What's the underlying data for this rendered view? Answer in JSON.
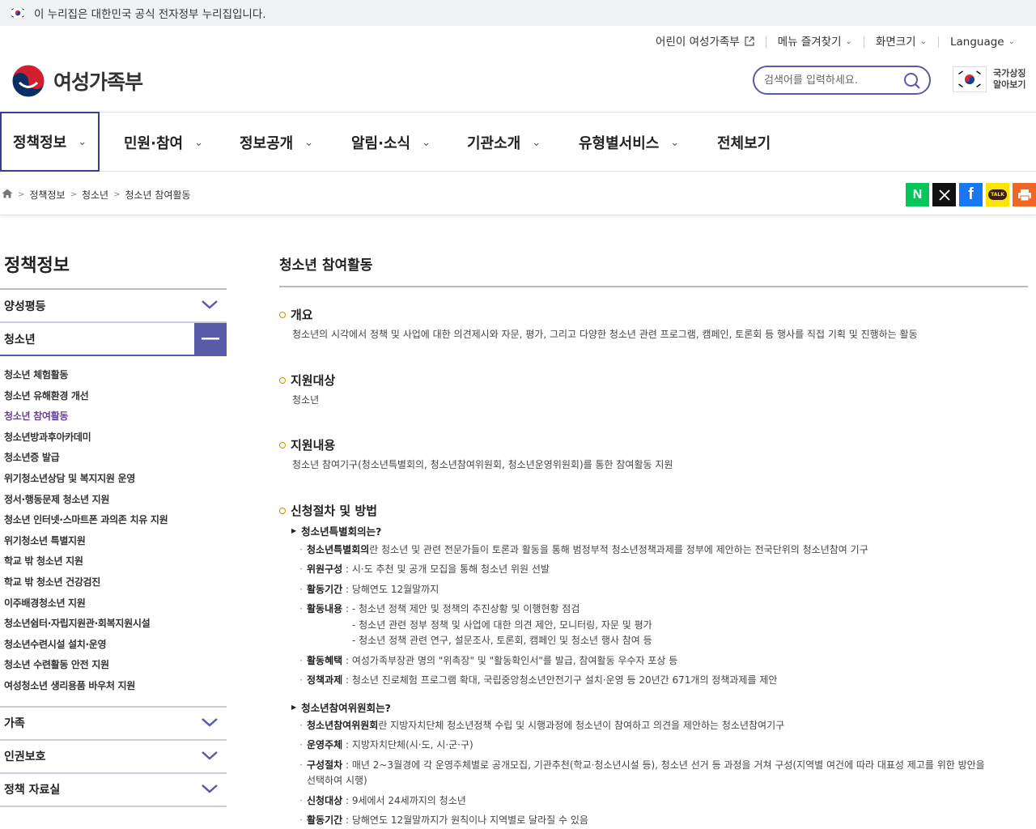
{
  "gov_banner": {
    "text": "이 누리집은 대한민국 공식 전자정부 누리집입니다."
  },
  "utility": {
    "kids": "어린이 여성가족부",
    "favorites": "메뉴 즐겨찾기",
    "font_size": "화면크기",
    "language": "Language"
  },
  "header": {
    "logo_text": "여성가족부",
    "search_placeholder": "검색어를 입력하세요.",
    "symbol_line1": "국가상징",
    "symbol_line2": "알아보기"
  },
  "gnb": {
    "tabs": [
      {
        "label": "정책정보"
      },
      {
        "label": "민원·참여"
      },
      {
        "label": "정보공개"
      },
      {
        "label": "알림·소식"
      },
      {
        "label": "기관소개"
      },
      {
        "label": "유형별서비스"
      },
      {
        "label": "전체보기"
      }
    ]
  },
  "breadcrumb": [
    "정책정보",
    "청소년",
    "청소년 참여활동"
  ],
  "share": {
    "naver": "N",
    "x": "X",
    "facebook": "f",
    "kakao": "TALK"
  },
  "colors": {
    "accent": "#5a5ba8",
    "active_sub": "#6b3fa0",
    "bullet_ring": "#d48a00",
    "naver": "#03c75a",
    "facebook": "#1877f2",
    "kakao": "#fee500",
    "print": "#f26522"
  },
  "lnb": {
    "title": "정책정보",
    "groups": [
      "양성평등",
      "청소년",
      "가족",
      "인권보호",
      "정책 자료실"
    ],
    "sub_items": [
      "청소년 체험활동",
      "청소년 유해환경 개선",
      "청소년 참여활동",
      "청소년방과후아카데미",
      "청소년증 발급",
      "위기청소년상담 및 복지지원 운영",
      "정서·행동문제 청소년 지원",
      "청소년 인터넷·스마트폰 과의존 치유 지원",
      "위기청소년 특별지원",
      "학교 밖 청소년 지원",
      "학교 밖 청소년 건강검진",
      "이주배경청소년 지원",
      "청소년쉼터·자립지원관·회복지원시설",
      "청소년수련시설 설치·운영",
      "청소년 수련활동 안전 지원",
      "여성청소년 생리용품 바우처 지원"
    ]
  },
  "content": {
    "title": "청소년 참여활동",
    "overview_h": "개요",
    "overview_p": "청소년의 시각에서 정책 및 사업에 대한 의견제시와 자문, 평가, 그리고 다양한 청소년 관련 프로그램, 캠페인, 토론회 등 행사를 직접 기획 및 진행하는 활동",
    "target_h": "지원대상",
    "target_p": "청소년",
    "content_h": "지원내용",
    "content_p": "청소년 참여기구(청소년특별회의, 청소년참여위원회, 청소년운영위원회)를 통한 참여활동 지원",
    "proc_h": "신청절차 및 방법",
    "special": {
      "h": "청소년특별회의는?",
      "def_b": "청소년특별회의",
      "def_t": "란 청소년 및 관련 전문가들이 토론과 활동을 통해 범정부적 청소년정책과제를 정부에 제안하는 전국단위의 청소년참여 기구",
      "comp_b": "위원구성",
      "comp_t": " : 시·도 추천 및 공개 모집을 통해 청소년 위원 선발",
      "period_b": "활동기간",
      "period_t": " : 당해연도 12월말까지",
      "act_b": "활동내용",
      "act_t1": " : - 청소년 정책 제안 및 정책의 추진상황 및 이행현황 점검",
      "act_t2": "- 청소년 관련 정부 정책 및 사업에 대한 의견 제안, 모니터링, 자문 및 평가",
      "act_t3": "- 청소년 정책 관련 연구, 설문조사, 토론회, 캠페인 및 청소년 행사 참여 등",
      "benefit_b": "활동혜택",
      "benefit_t": " : 여성가족부장관 명의 \"위촉장\" 및 \"활동확인서\"를 발급, 참여활동 우수자 포상 등",
      "task_b": "정책과제",
      "task_t": " : 청소년 진로체험 프로그램 확대, 국립중앙청소년안전기구 설치·운영 등 20년간 671개의 정책과제를 제안"
    },
    "committee": {
      "h": "청소년참여위원회는?",
      "def_b": "청소년참여위원회",
      "def_t": "란 지방자치단체 청소년정책 수립 및 시행과정에 청소년이 참여하고 의견을 제안하는 청소년참여기구",
      "org_b": "운영주체",
      "org_t": " : 지방자치단체(시·도, 시·군·구)",
      "proc_b": "구성절차",
      "proc_t1": " : 매년 2~3월경에 각 운영주체별로 공개모집, 기관추천(학교·청소년시설 등), 청소년 선거 등 과정을 거쳐 구성(지역별 여건에 따라 대표성 제고를 위한 방안을",
      "proc_t2": "선택하여 시행)",
      "target_b": "신청대상",
      "target_t": " : 9세에서 24세까지의 청소년",
      "period_b": "활동기간",
      "period_t": " : 당해연도 12월말까지가 원칙이나 지역별로 달라질 수 있음"
    }
  }
}
